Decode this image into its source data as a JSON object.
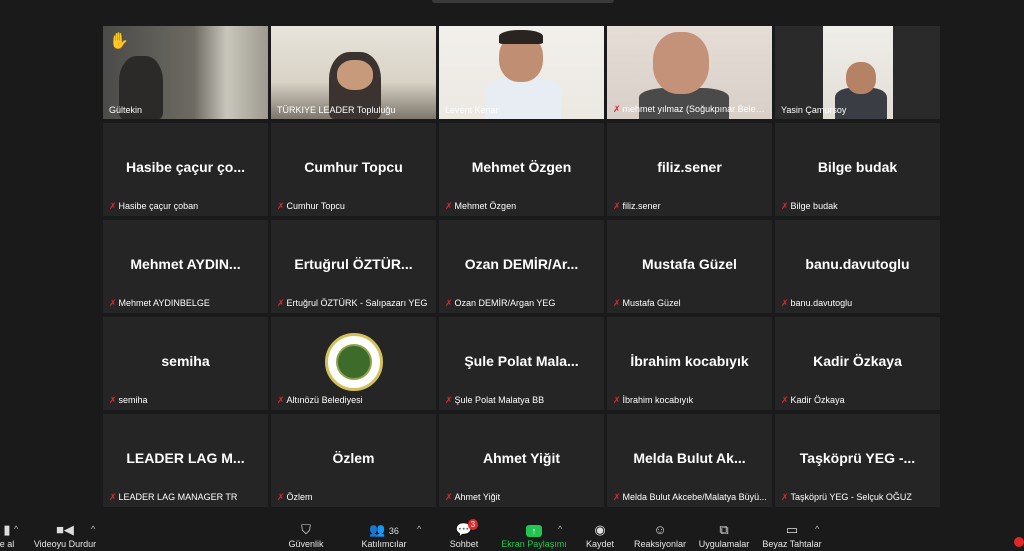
{
  "participants": [
    {
      "tile_name": "",
      "plate": "Gültekin",
      "muted": false,
      "video": true,
      "hand": true
    },
    {
      "tile_name": "",
      "plate": "TÜRKIYE LEADER Topluluğu",
      "muted": false,
      "video": true
    },
    {
      "tile_name": "",
      "plate": "Levent Kenar",
      "muted": false,
      "video": true
    },
    {
      "tile_name": "",
      "plate": "mehmet yılmaz (Soğukpınar Beled...",
      "muted": true,
      "video": true
    },
    {
      "tile_name": "",
      "plate": "Yasin Çamursoy",
      "muted": false,
      "video": true
    },
    {
      "tile_name": "Hasibe çaçur ço...",
      "plate": "Hasibe çaçur çoban",
      "muted": true
    },
    {
      "tile_name": "Cumhur Topcu",
      "plate": "Cumhur Topcu",
      "muted": true
    },
    {
      "tile_name": "Mehmet Özgen",
      "plate": "Mehmet Özgen",
      "muted": true
    },
    {
      "tile_name": "filiz.sener",
      "plate": "filiz.sener",
      "muted": true
    },
    {
      "tile_name": "Bilge budak",
      "plate": "Bilge budak",
      "muted": true
    },
    {
      "tile_name": "Mehmet  AYDIN...",
      "plate": "Mehmet AYDINBELGE",
      "muted": true
    },
    {
      "tile_name": "Ertuğrul ÖZTÜR...",
      "plate": "Ertuğrul ÖZTÜRK - Salıpazarı YEG",
      "muted": true
    },
    {
      "tile_name": "Ozan  DEMİR/Ar...",
      "plate": "Ozan DEMİR/Argan YEG",
      "muted": true
    },
    {
      "tile_name": "Mustafa Güzel",
      "plate": "Mustafa Güzel",
      "muted": true
    },
    {
      "tile_name": "banu.davutoglu",
      "plate": "banu.davutoglu",
      "muted": true
    },
    {
      "tile_name": "semiha",
      "plate": "semiha",
      "muted": true
    },
    {
      "tile_name": "",
      "plate": "Altınözü Belediyesi",
      "muted": true,
      "logo": true
    },
    {
      "tile_name": "Şule Polat  Mala...",
      "plate": "Şule Polat Malatya BB",
      "muted": true
    },
    {
      "tile_name": "İbrahim kocabıyık",
      "plate": "İbrahim kocabıyık",
      "muted": true
    },
    {
      "tile_name": "Kadir Özkaya",
      "plate": "Kadir Özkaya",
      "muted": true
    },
    {
      "tile_name": "LEADER  LAG  M...",
      "plate": "LEADER LAG MANAGER TR",
      "muted": true
    },
    {
      "tile_name": "Özlem",
      "plate": "Özlem",
      "muted": true
    },
    {
      "tile_name": "Ahmet Yiğit",
      "plate": "Ahmet Yiğit",
      "muted": true
    },
    {
      "tile_name": "Melda Bulut  Ak...",
      "plate": "Melda Bulut Akcebe/Malatya Büyü...",
      "muted": true
    },
    {
      "tile_name": "Taşköprü YEG -...",
      "plate": "Taşköprü YEG - Selçuk OĞUZ",
      "muted": true
    }
  ],
  "toolbar": {
    "audio_label": "e al",
    "video_label": "Videoyu Durdur",
    "security_label": "Güvenlik",
    "participants_label": "Katılımcılar",
    "participants_count": "36",
    "chat_label": "Sohbet",
    "chat_badge": "3",
    "share_label": "Ekran Paylaşımı",
    "record_label": "Kaydet",
    "reactions_label": "Reaksiyonlar",
    "apps_label": "Uygulamalar",
    "whiteboard_label": "Beyaz Tahtalar"
  },
  "colors": {
    "active_speaker": "#c4d630",
    "muted_mic": "#e02828",
    "share_green": "#23c552"
  }
}
